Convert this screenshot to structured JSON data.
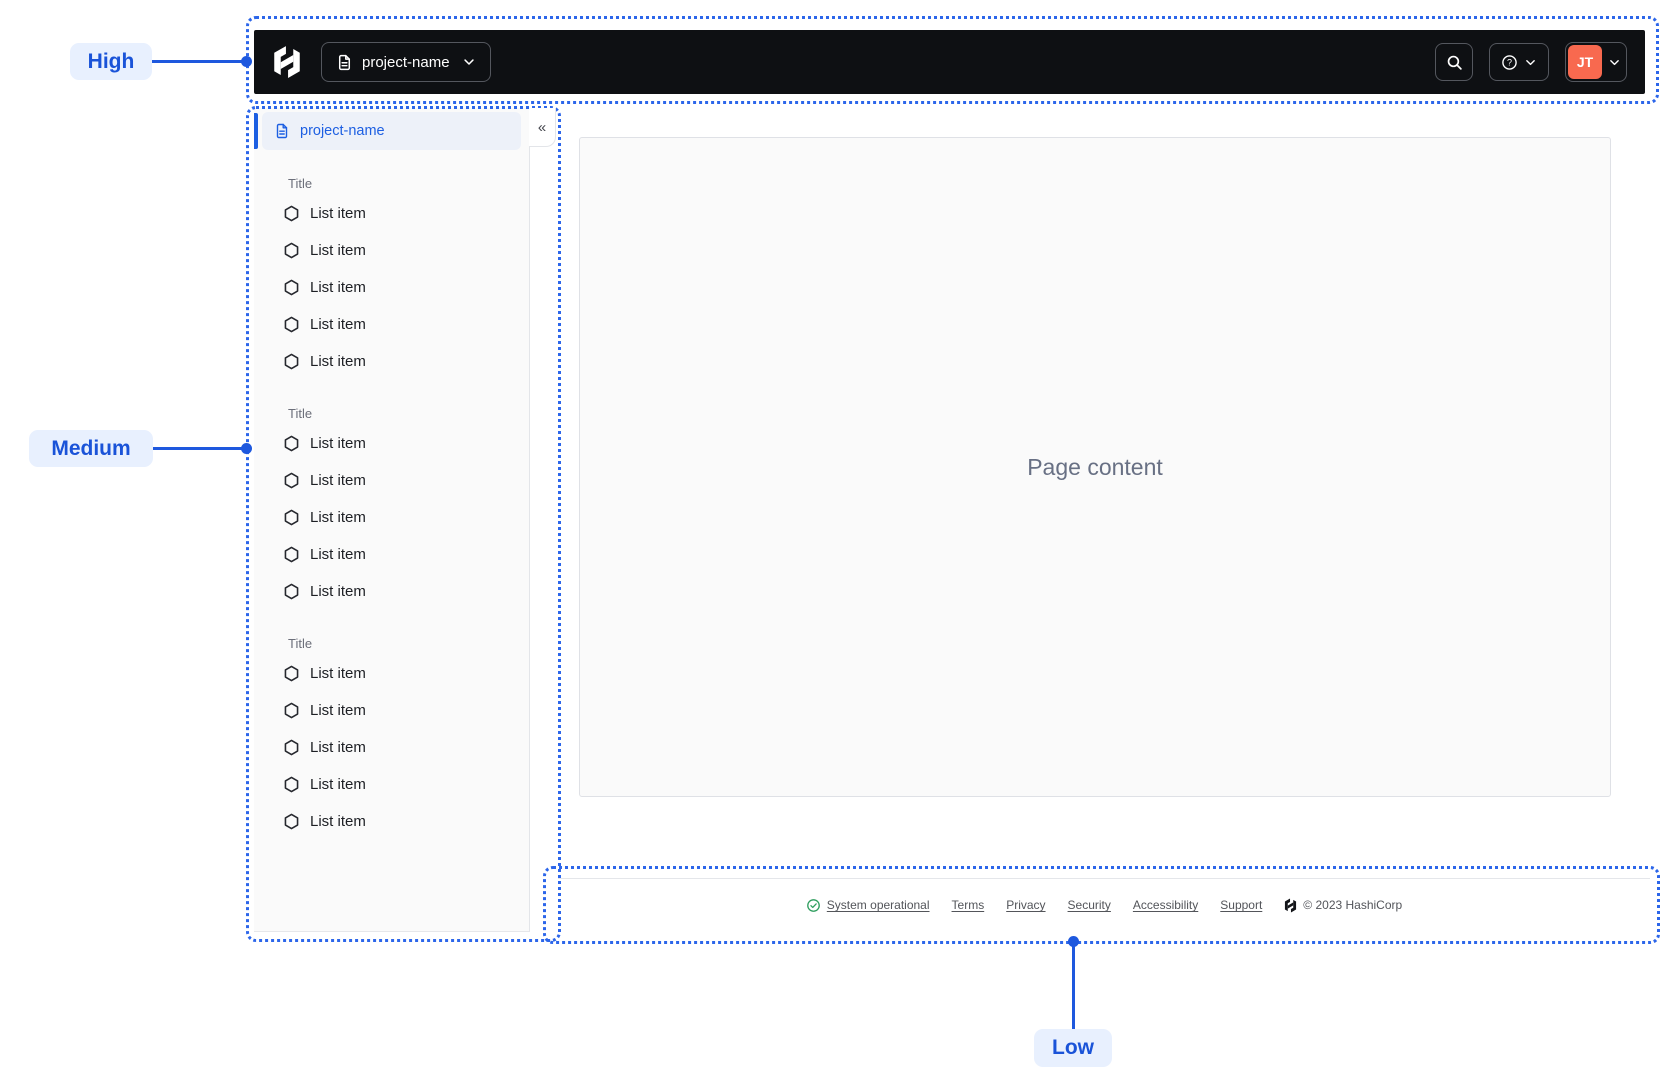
{
  "annotations": {
    "high": "High",
    "medium": "Medium",
    "low": "Low"
  },
  "topbar": {
    "project_menu": {
      "label": "project-name"
    },
    "avatar": {
      "initials": "JT"
    }
  },
  "sidebar": {
    "active_item": {
      "label": "project-name"
    },
    "collapse_glyph": "«",
    "sections": [
      {
        "title": "Title",
        "items": [
          "List item",
          "List item",
          "List item",
          "List item",
          "List item"
        ]
      },
      {
        "title": "Title",
        "items": [
          "List item",
          "List item",
          "List item",
          "List item",
          "List item"
        ]
      },
      {
        "title": "Title",
        "items": [
          "List item",
          "List item",
          "List item",
          "List item",
          "List item"
        ]
      }
    ]
  },
  "main": {
    "placeholder": "Page content"
  },
  "footer": {
    "status": "System operational",
    "links": [
      "Terms",
      "Privacy",
      "Security",
      "Accessibility",
      "Support"
    ],
    "copyright": "© 2023 HashiCorp"
  },
  "colors": {
    "annotation_blue": "#1e58de",
    "region_border": "#2c66ea",
    "annotation_label_bg": "#e8f0fe",
    "topbar_bg": "#0e1013",
    "avatar_bg": "#f8694f",
    "accent_blue": "#1d5fe2",
    "status_green": "#2f9e5f",
    "sidebar_bg": "#fafafa"
  }
}
